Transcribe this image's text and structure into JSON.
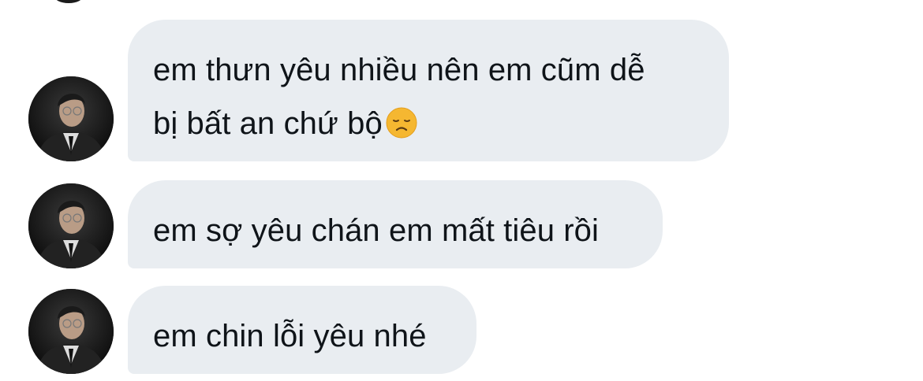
{
  "conversation": {
    "messages": [
      {
        "lines": [
          "em thưn yêu nhiều nên em cũm dễ",
          "bị bất an chứ bộ"
        ],
        "emoji": "disappointed-face-emoji"
      },
      {
        "lines": [
          "em sợ yêu chán em mất tiêu rồi"
        ]
      },
      {
        "lines": [
          "em chin lỗi yêu nhé"
        ]
      }
    ]
  },
  "colors": {
    "bubble": "#e9edf1",
    "text": "#0f1419",
    "emoji": "#f5b731"
  }
}
